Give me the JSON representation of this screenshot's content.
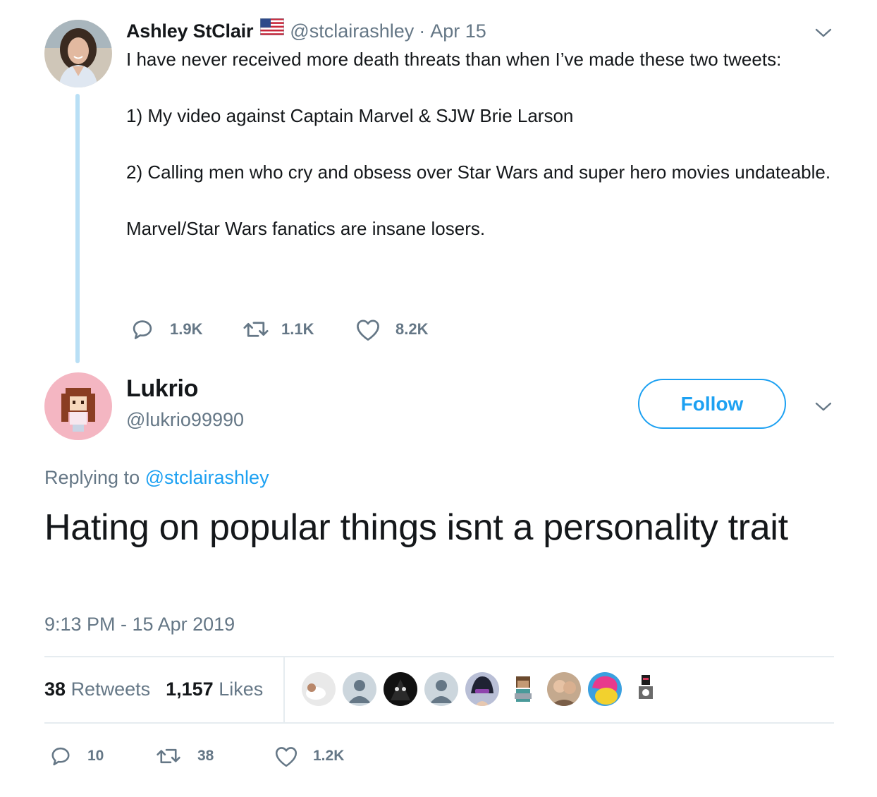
{
  "parent_tweet": {
    "display_name": "Ashley StClair",
    "handle": "@stclairashley",
    "separator": "·",
    "date": "Apr 15",
    "flag_icon": "us-flag-icon",
    "lines": [
      "I have never received more death threats than when I’ve made these two tweets:",
      "",
      "1) My video against Captain Marvel & SJW Brie Larson",
      "",
      "2) Calling men who cry and obsess over Star Wars and super hero movies undateable.",
      "",
      "Marvel/Star Wars fanatics are insane losers."
    ],
    "actions": {
      "replies": "1.9K",
      "retweets": "1.1K",
      "likes": "8.2K"
    }
  },
  "main_tweet": {
    "display_name": "Lukrio",
    "handle": "@lukrio99990",
    "follow_label": "Follow",
    "replying_prefix": "Replying to",
    "replying_handle": "@stclairashley",
    "text": "Hating on popular things isnt a personality trait",
    "timestamp": "9:13 PM - 15 Apr 2019",
    "stats": {
      "retweets_count": "38",
      "retweets_label": "Retweets",
      "likes_count": "1,157",
      "likes_label": "Likes"
    },
    "liker_avatars": [
      "avatar-1",
      "avatar-2",
      "avatar-3",
      "avatar-4",
      "avatar-5",
      "avatar-6",
      "avatar-7",
      "avatar-8",
      "avatar-9"
    ],
    "actions": {
      "replies": "10",
      "retweets": "38",
      "likes": "1.2K"
    }
  },
  "colors": {
    "accent": "#1da1f2",
    "text_primary": "#14171a",
    "text_secondary": "#657786",
    "thread_line": "#b9dff5",
    "divider": "#e6ecf0"
  }
}
